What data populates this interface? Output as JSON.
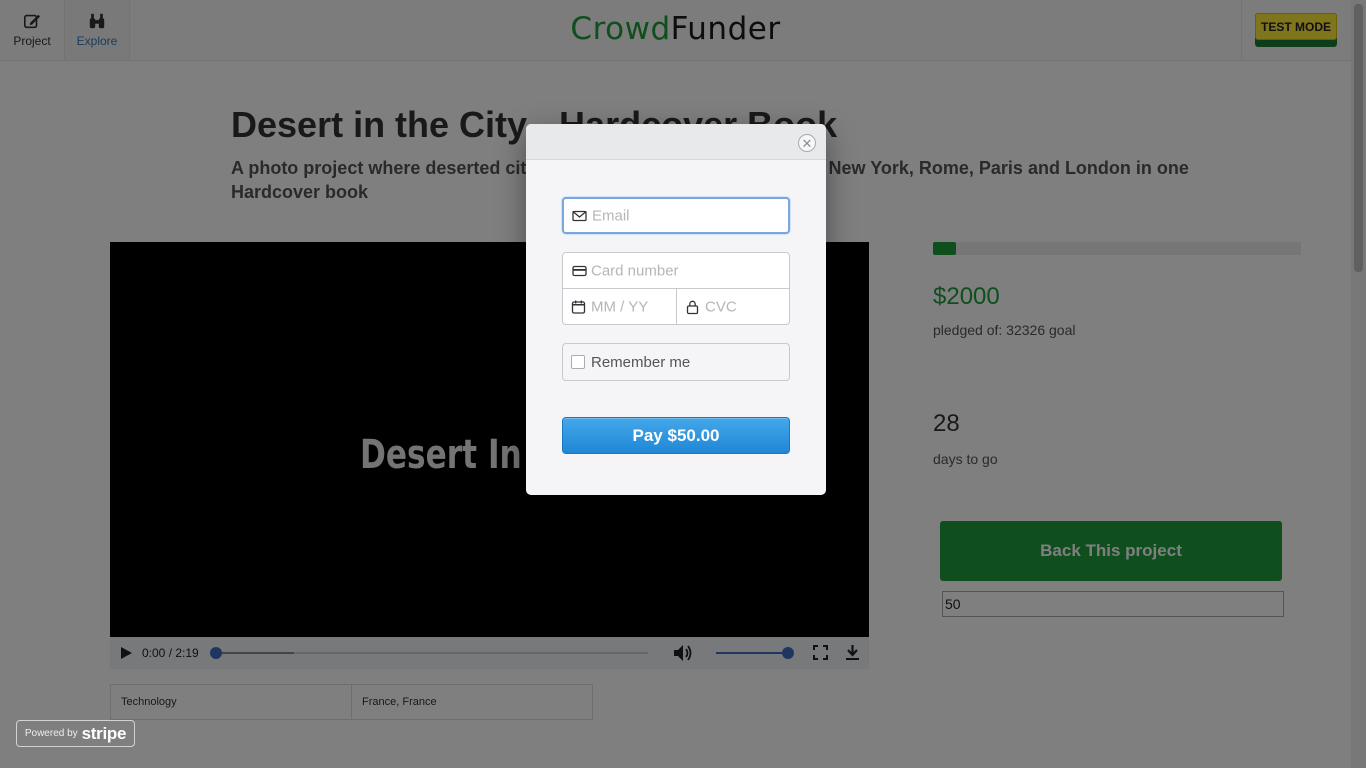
{
  "nav": {
    "project_label": "Project",
    "explore_label": "Explore",
    "brand_part1": "Crowd",
    "brand_part2": "Funder",
    "test_mode_label": "TEST MODE"
  },
  "project": {
    "title": "Desert in the City - Hardcover Book",
    "subtitle": "A photo project where deserted cities are the main characters. Empty New York, Rome, Paris and London in one Hardcover book"
  },
  "video": {
    "frame_title": "Desert In The City",
    "time": "0:00 / 2:19",
    "seek_position": 0.0,
    "buffered_fraction": 0.18,
    "volume_level": 1.0
  },
  "tags": {
    "category": "Technology",
    "location": "France, France"
  },
  "stats": {
    "progress_fraction": 0.062,
    "pledged_amount": "$2000",
    "pledged_text": "pledged of: 32326 goal",
    "days_left": "28",
    "days_text": "days to go"
  },
  "back": {
    "button_label": "Back This project",
    "amount_value": "50"
  },
  "checkout": {
    "email_placeholder": "Email",
    "card_placeholder": "Card number",
    "expiry_placeholder": "MM / YY",
    "cvc_placeholder": "CVC",
    "remember_label": "Remember me",
    "pay_label": "Pay $50.00",
    "close_symbol": "✕"
  },
  "stripe": {
    "powered_by": "Powered by",
    "brand": "stripe"
  },
  "colors": {
    "brand_green": "#1f9d3a",
    "pay_blue": "#2b95df",
    "test_mode_yellow": "#ffeb3b"
  },
  "icons": [
    "pencil-square-icon",
    "binoculars-icon",
    "play-icon",
    "volume-icon",
    "fullscreen-icon",
    "download-icon",
    "envelope-icon",
    "credit-card-icon",
    "calendar-icon",
    "lock-icon",
    "close-icon"
  ]
}
